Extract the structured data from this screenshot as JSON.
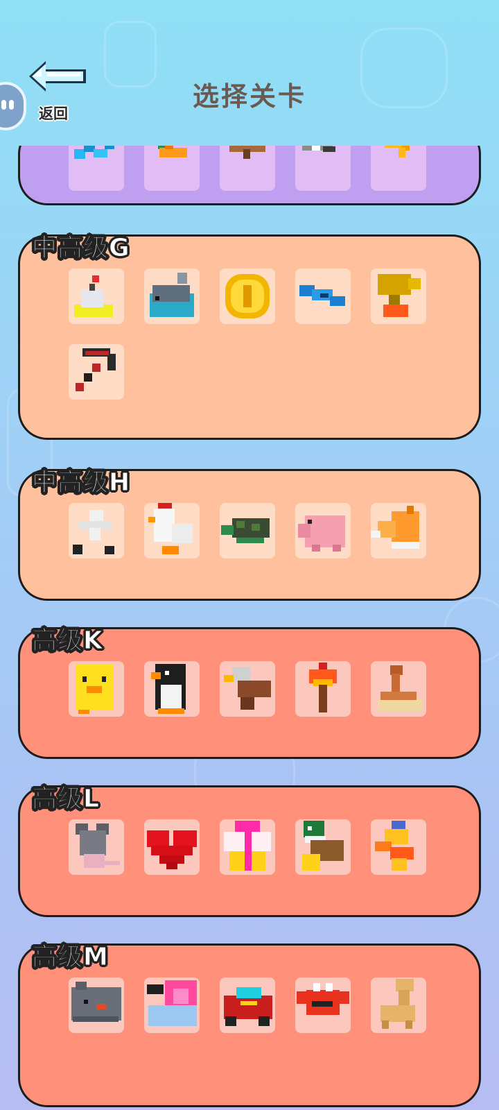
{
  "header": {
    "title": "选择关卡",
    "back_label": "返回"
  },
  "colors": {
    "lavender": "#bf9ff0",
    "peach": "#ffc09d",
    "salmon": "#ff907a"
  },
  "levels": [
    {
      "title": "",
      "icons": [
        "blue-shape-icon",
        "orange-dino-icon",
        "brown-animal-icon",
        "gray-robot-icon",
        "yellow-shape-icon"
      ]
    },
    {
      "title": "中高级G",
      "icons": [
        "bomb-icon",
        "whale-icon",
        "gold-coin-icon",
        "blue-fish-icon",
        "trophy-icon",
        "pickaxe-icon"
      ]
    },
    {
      "title": "中高级H",
      "icons": [
        "skeleton-icon",
        "chicken-icon",
        "turtle-icon",
        "pig-icon",
        "corgi-icon"
      ]
    },
    {
      "title": "高级K",
      "icons": [
        "yellow-chick-icon",
        "penguin-icon",
        "eagle-icon",
        "torch-icon",
        "snake-icon"
      ]
    },
    {
      "title": "高级L",
      "icons": [
        "mouse-icon",
        "heart-icon",
        "gift-box-icon",
        "duck-icon",
        "fish-toy-icon"
      ]
    },
    {
      "title": "高级M",
      "icons": [
        "rhino-icon",
        "snail-icon",
        "race-car-icon",
        "crab-icon",
        "alpaca-icon"
      ]
    }
  ]
}
